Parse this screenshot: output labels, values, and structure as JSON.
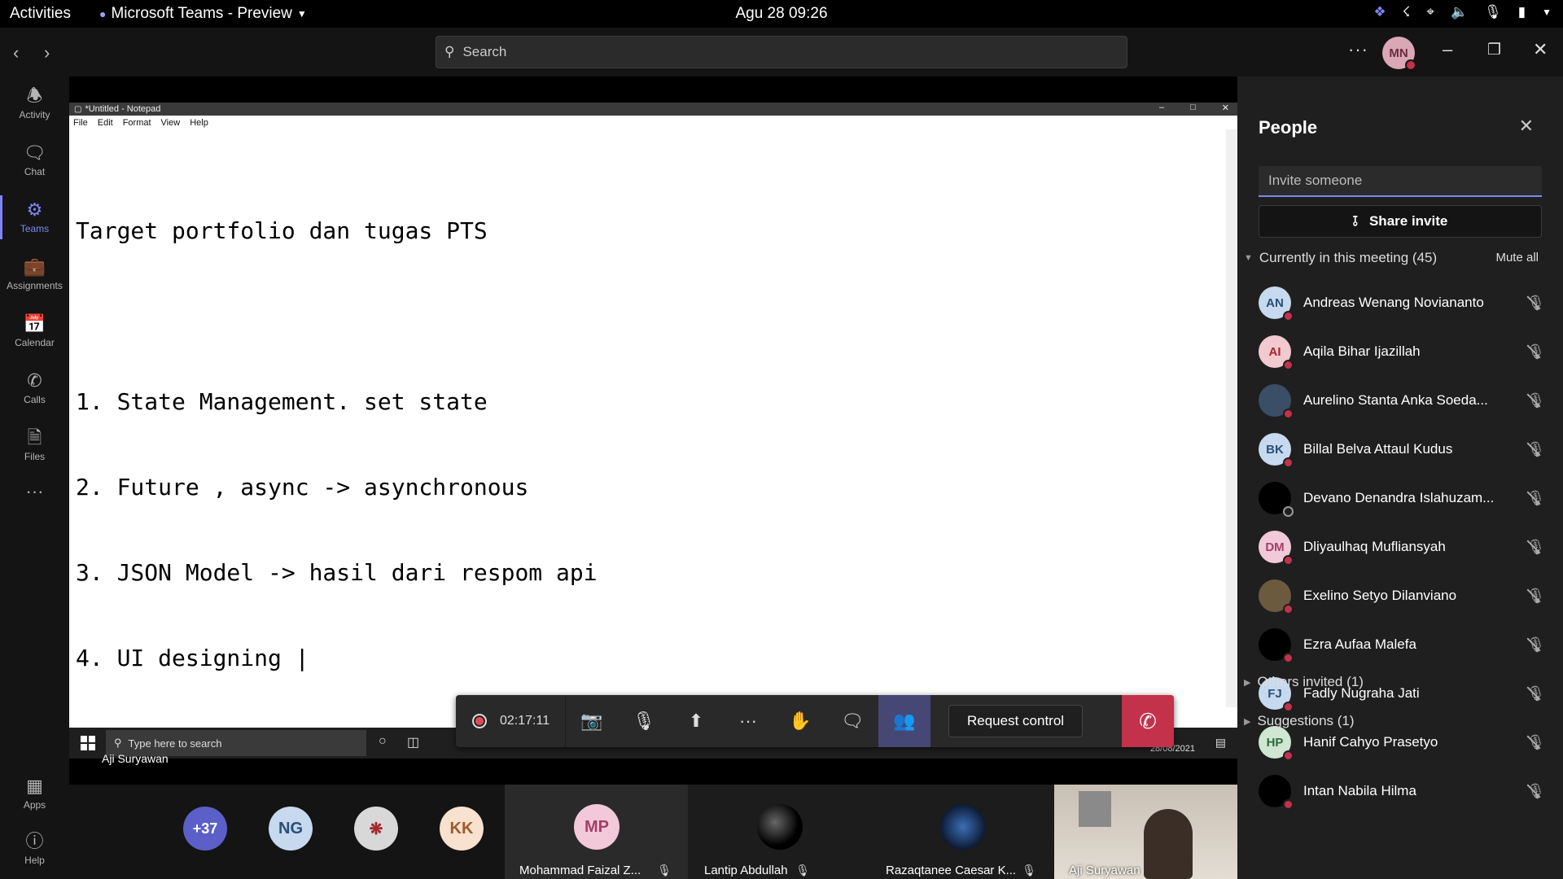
{
  "topbar": {
    "activities": "Activities",
    "app_name": "Microsoft Teams - Preview",
    "clock": "Agu 28  09:26"
  },
  "titlebar": {
    "search_placeholder": "Search",
    "avatar_initials": "MN"
  },
  "rail": {
    "items": [
      {
        "label": "Activity",
        "icon": "bell-icon"
      },
      {
        "label": "Chat",
        "icon": "chat-icon"
      },
      {
        "label": "Teams",
        "icon": "teams-icon"
      },
      {
        "label": "Assignments",
        "icon": "assignments-icon"
      },
      {
        "label": "Calendar",
        "icon": "calendar-icon"
      },
      {
        "label": "Calls",
        "icon": "phone-icon"
      },
      {
        "label": "Files",
        "icon": "file-icon"
      }
    ],
    "apps_label": "Apps",
    "help_label": "Help"
  },
  "shared": {
    "window_title": "*Untitled - Notepad",
    "menu": [
      "File",
      "Edit",
      "Format",
      "View",
      "Help"
    ],
    "lines": [
      "Target portfolio dan tugas PTS",
      "",
      "1. State Management. set state",
      "2. Future , async -> asynchronous",
      "3. JSON Model -> hasil dari respom api",
      "4. UI designing |"
    ],
    "taskbar_search": "Type here to search",
    "taskbar_date": "28/08/2021",
    "presenter": "Aji Suryawan"
  },
  "controls": {
    "timer": "02:17:11",
    "request_control": "Request control"
  },
  "gallery": {
    "overflow": "+37",
    "avatars": [
      {
        "initials": "NG"
      },
      {
        "initials": "KK"
      }
    ],
    "tiles": [
      {
        "name": "Mohammad Faizal Z...",
        "initials": "MP"
      },
      {
        "name": "Lantip Abdullah"
      },
      {
        "name": "Razaqtanee Caesar K..."
      },
      {
        "name": "Aji Suryawan"
      }
    ]
  },
  "people": {
    "title": "People",
    "invite_placeholder": "Invite someone",
    "share_invite": "Share invite",
    "in_meeting": "Currently in this meeting (45)",
    "mute_all": "Mute all",
    "participants": [
      {
        "initials": "AN",
        "name": "Andreas Wenang Noviananto",
        "bg": "#c7d9ee",
        "fg": "#2a4f7a"
      },
      {
        "initials": "AI",
        "name": "Aqila Bihar Ijazillah",
        "bg": "#f2c9cf",
        "fg": "#a4262c"
      },
      {
        "initials": "",
        "name": "Aurelino Stanta Anka Soeda...",
        "bg": "#3a4e66",
        "fg": "#fff"
      },
      {
        "initials": "BK",
        "name": "Billal Belva Attaul Kudus",
        "bg": "#c7d9ee",
        "fg": "#2a4f7a"
      },
      {
        "initials": "",
        "name": "Devano Denandra Islahuzam...",
        "bg": "#000000",
        "fg": "#fff"
      },
      {
        "initials": "DM",
        "name": "Dliyaulhaq Mufliansyah",
        "bg": "#f2c9d8",
        "fg": "#a43d6b"
      },
      {
        "initials": "",
        "name": "Exelino Setyo Dilanviano",
        "bg": "#6b5a3e",
        "fg": "#fff"
      },
      {
        "initials": "",
        "name": "Ezra Aufaa Malefa",
        "bg": "#000000",
        "fg": "#fff"
      },
      {
        "initials": "FJ",
        "name": "Fadly Nugraha Jati",
        "bg": "#c7d9ee",
        "fg": "#2a4f7a"
      },
      {
        "initials": "HP",
        "name": "Hanif Cahyo Prasetyo",
        "bg": "#cfe6d2",
        "fg": "#2e6b3a"
      },
      {
        "initials": "",
        "name": "Intan Nabila Hilma",
        "bg": "#000000",
        "fg": "#fff"
      }
    ],
    "others_invited": "Others invited  (1)",
    "suggestions": "Suggestions  (1)"
  }
}
